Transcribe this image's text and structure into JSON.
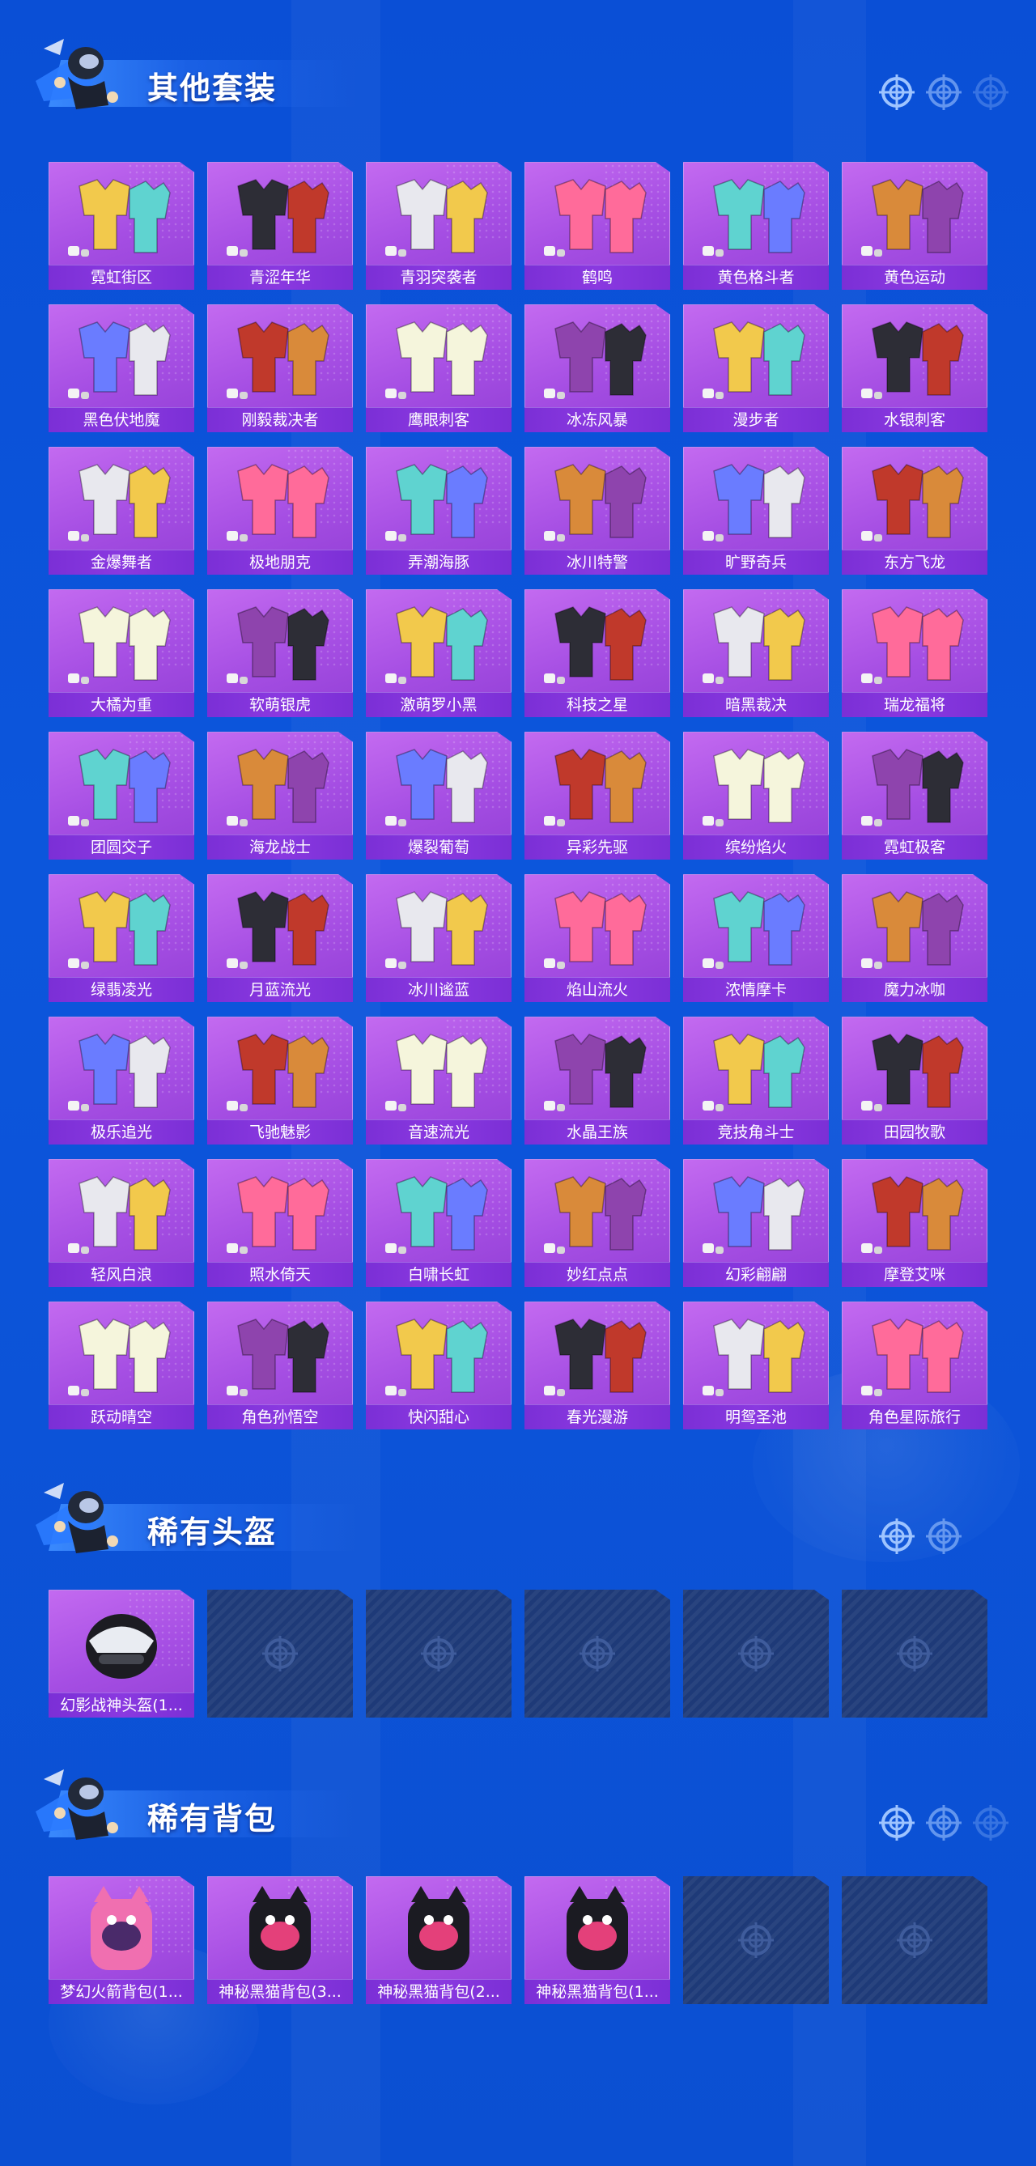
{
  "sections": {
    "suits": {
      "title": "其他套装",
      "items": [
        "霓虹街区",
        "青涩年华",
        "青羽突袭者",
        "鹤鸣",
        "黄色格斗者",
        "黄色运动",
        "黑色伏地魔",
        "刚毅裁决者",
        "鹰眼刺客",
        "冰冻风暴",
        "漫步者",
        "水银刺客",
        "金爆舞者",
        "极地朋克",
        "弄潮海豚",
        "冰川特警",
        "旷野奇兵",
        "东方飞龙",
        "大橘为重",
        "软萌银虎",
        "激萌罗小黑",
        "科技之星",
        "暗黑裁决",
        "瑞龙福将",
        "团圆交子",
        "海龙战士",
        "爆裂葡萄",
        "异彩先驱",
        "缤纷焰火",
        "霓虹极客",
        "绿翡凌光",
        "月蓝流光",
        "冰川谧蓝",
        "焰山流火",
        "浓情摩卡",
        "魔力冰咖",
        "极乐追光",
        "飞驰魅影",
        "音速流光",
        "水晶王族",
        "竞技角斗士",
        "田园牧歌",
        "轻风白浪",
        "照水倚天",
        "白啸长虹",
        "妙红点点",
        "幻彩翩翩",
        "摩登艾咪",
        "跃动晴空",
        "角色孙悟空",
        "快闪甜心",
        "春光漫游",
        "明鸳圣池",
        "角色星际旅行"
      ]
    },
    "helmets": {
      "title": "稀有头盔",
      "items": [
        "幻影战神头盔(1..."
      ]
    },
    "backpacks": {
      "title": "稀有背包",
      "items": [
        "梦幻火箭背包(1...",
        "神秘黑猫背包(3...",
        "神秘黑猫背包(2...",
        "神秘黑猫背包(1..."
      ]
    }
  },
  "colors": {
    "background": "#0b52d8",
    "card": "#a54ee3",
    "label_bar": "#8a39e0",
    "empty_slot": "#1e3a78"
  },
  "icons": {
    "header_deco": "crosshair-icon",
    "empty_slot": "crosshair-icon",
    "mascot": "mascot-icon"
  }
}
